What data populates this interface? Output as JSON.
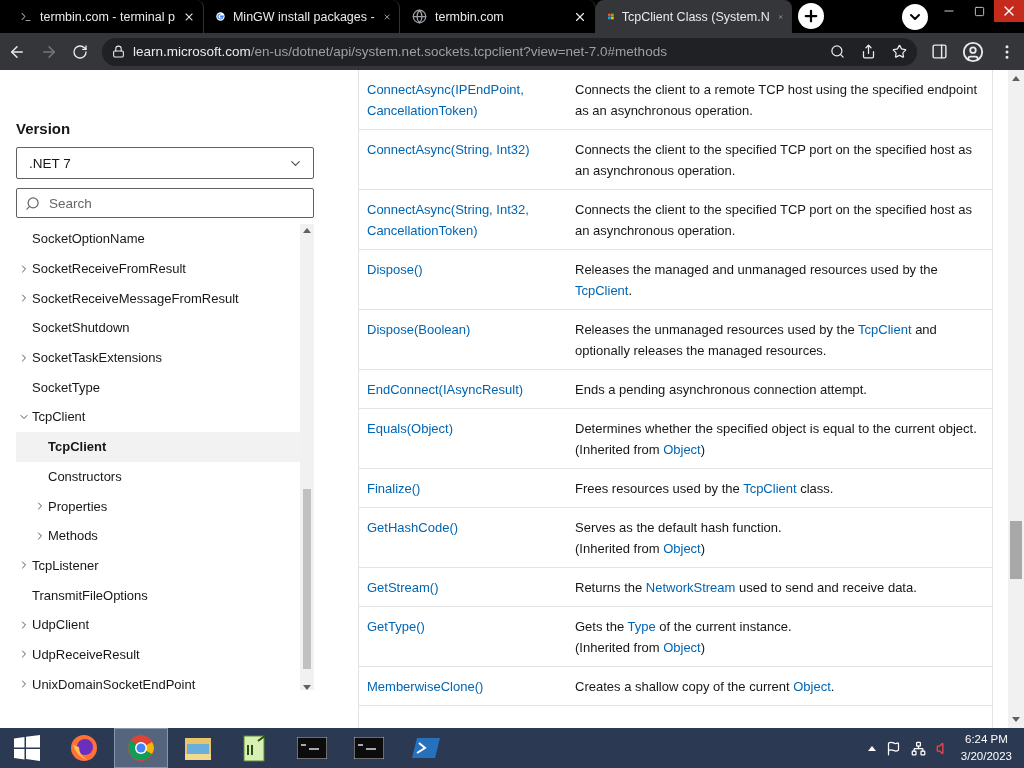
{
  "browser": {
    "tabs": [
      {
        "title": "termbin.com - terminal p",
        "selected": false
      },
      {
        "title": "MinGW install packages -",
        "selected": false
      },
      {
        "title": "termbin.com",
        "selected": false
      },
      {
        "title": "TcpClient Class (System.N",
        "selected": true
      }
    ],
    "url_host": "learn.microsoft.com",
    "url_path": "/en-us/dotnet/api/system.net.sockets.tcpclient?view=net-7.0#methods"
  },
  "sidebar": {
    "version_label": "Version",
    "version_value": ".NET 7",
    "search_placeholder": "Search",
    "tree": [
      {
        "label": "SocketOptionName",
        "selected": false
      },
      {
        "label": "SocketReceiveFromResult",
        "selected": false,
        "expanded": false
      },
      {
        "label": "SocketReceiveMessageFromResult",
        "selected": false,
        "expanded": false
      },
      {
        "label": "SocketShutdown",
        "selected": false
      },
      {
        "label": "SocketTaskExtensions",
        "selected": false,
        "expanded": false
      },
      {
        "label": "SocketType",
        "selected": false
      },
      {
        "label": "TcpClient",
        "selected": false,
        "expanded": true,
        "children": [
          {
            "label": "TcpClient",
            "selected": true
          },
          {
            "label": "Constructors",
            "selected": false
          },
          {
            "label": "Properties",
            "selected": false,
            "expanded": false
          },
          {
            "label": "Methods",
            "selected": false,
            "expanded": false
          }
        ]
      },
      {
        "label": "TcpListener",
        "selected": false,
        "expanded": false
      },
      {
        "label": "TransmitFileOptions",
        "selected": false
      },
      {
        "label": "UdpClient",
        "selected": false,
        "expanded": false
      },
      {
        "label": "UdpReceiveResult",
        "selected": false,
        "expanded": false
      },
      {
        "label": "UnixDomainSocketEndPoint",
        "selected": false,
        "expanded": false
      }
    ]
  },
  "methods": [
    {
      "name": [
        "ConnectAsync(IPEndPoint,",
        "CancellationToken)"
      ],
      "description": [
        [
          {
            "text": "Connects the client to a remote TCP host using the specified endpoint as an asynchronous operation."
          }
        ]
      ]
    },
    {
      "name": [
        "ConnectAsync(String, Int32)"
      ],
      "description": [
        [
          {
            "text": "Connects the client to the specified TCP port on the specified host as an asynchronous operation."
          }
        ]
      ]
    },
    {
      "name": [
        "ConnectAsync(String, Int32,",
        "CancellationToken)"
      ],
      "description": [
        [
          {
            "text": "Connects the client to the specified TCP port on the specified host as an asynchronous operation."
          }
        ]
      ]
    },
    {
      "name": [
        "Dispose()"
      ],
      "description": [
        [
          {
            "text": "Releases the managed and unmanaged resources used by the "
          },
          {
            "text": "TcpClient",
            "link": true
          },
          {
            "text": "."
          }
        ]
      ]
    },
    {
      "name": [
        "Dispose(Boolean)"
      ],
      "description": [
        [
          {
            "text": "Releases the unmanaged resources used by the "
          },
          {
            "text": "TcpClient",
            "link": true
          },
          {
            "text": " and optionally releases the managed resources."
          }
        ]
      ]
    },
    {
      "name": [
        "EndConnect(IAsyncResult)"
      ],
      "description": [
        [
          {
            "text": "Ends a pending asynchronous connection attempt."
          }
        ]
      ]
    },
    {
      "name": [
        "Equals(Object)"
      ],
      "description": [
        [
          {
            "text": "Determines whether the specified object is equal to the current object."
          }
        ],
        [
          {
            "text": "(Inherited from "
          },
          {
            "text": "Object",
            "link": true
          },
          {
            "text": ")"
          }
        ]
      ]
    },
    {
      "name": [
        "Finalize()"
      ],
      "description": [
        [
          {
            "text": "Frees resources used by the "
          },
          {
            "text": "TcpClient",
            "link": true
          },
          {
            "text": " class."
          }
        ]
      ]
    },
    {
      "name": [
        "GetHashCode()"
      ],
      "description": [
        [
          {
            "text": "Serves as the default hash function."
          }
        ],
        [
          {
            "text": "(Inherited from "
          },
          {
            "text": "Object",
            "link": true
          },
          {
            "text": ")"
          }
        ]
      ]
    },
    {
      "name": [
        "GetStream()"
      ],
      "description": [
        [
          {
            "text": "Returns the "
          },
          {
            "text": "NetworkStream",
            "link": true
          },
          {
            "text": " used to send and receive data."
          }
        ]
      ]
    },
    {
      "name": [
        "GetType()"
      ],
      "description": [
        [
          {
            "text": "Gets the "
          },
          {
            "text": "Type",
            "link": true
          },
          {
            "text": " of the current instance."
          }
        ],
        [
          {
            "text": "(Inherited from "
          },
          {
            "text": "Object",
            "link": true
          },
          {
            "text": ")"
          }
        ]
      ]
    },
    {
      "name": [
        "MemberwiseClone()"
      ],
      "description": [
        [
          {
            "text": "Creates a shallow copy of the current "
          },
          {
            "text": "Object",
            "link": true
          },
          {
            "text": "."
          }
        ]
      ]
    }
  ],
  "taskbar": {
    "apps": [
      {
        "selected": false
      },
      {
        "selected": true
      },
      {
        "selected": false
      },
      {
        "selected": false
      },
      {
        "selected": false
      },
      {
        "selected": false
      },
      {
        "selected": false
      }
    ],
    "time": "6:24 PM",
    "date": "3/20/2023"
  }
}
